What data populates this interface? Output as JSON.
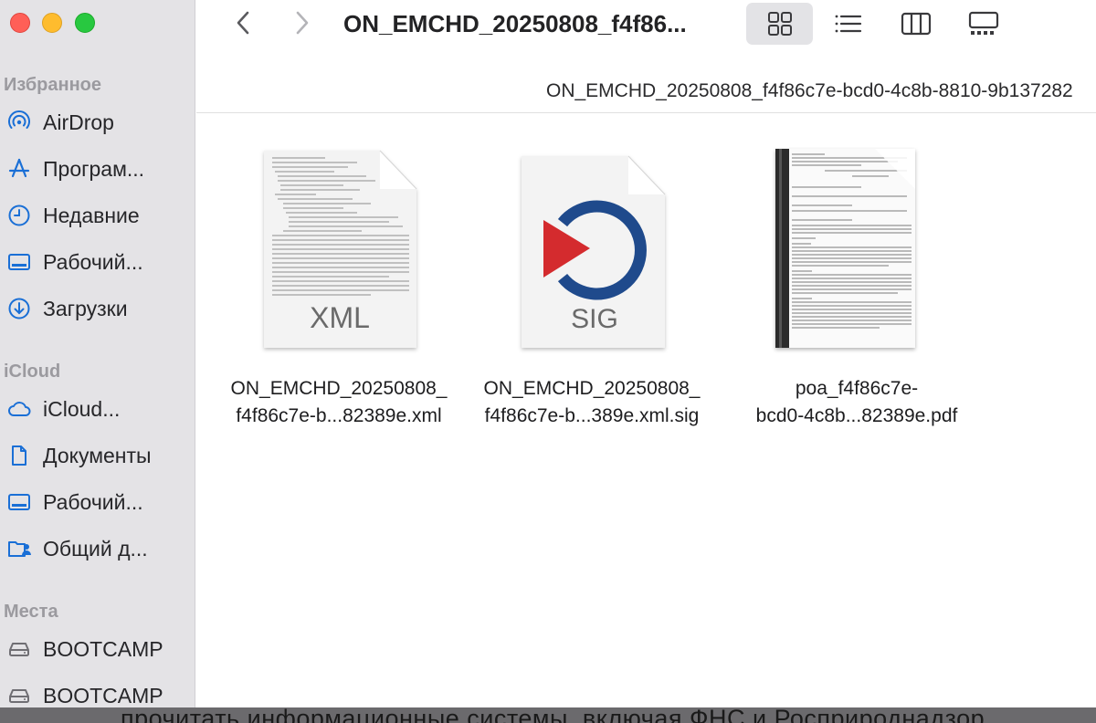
{
  "window": {
    "title": "ON_EMCHD_20250808_f4f86..."
  },
  "path_bar": {
    "current": "ON_EMCHD_20250808_f4f86c7e-bcd0-4c8b-8810-9b137282"
  },
  "toolbar": {
    "back_icon": "chevron-left-icon",
    "forward_icon": "chevron-right-icon",
    "views": [
      "icon-view",
      "list-view",
      "column-view",
      "gallery-view"
    ],
    "active_view": "icon-view"
  },
  "sidebar": {
    "favorites_title": "Избранное",
    "favorites": [
      {
        "label": "AirDrop",
        "icon": "airdrop-icon"
      },
      {
        "label": "Програм...",
        "icon": "applications-icon"
      },
      {
        "label": "Недавние",
        "icon": "clock-icon"
      },
      {
        "label": "Рабочий...",
        "icon": "desktop-icon"
      },
      {
        "label": "Загрузки",
        "icon": "downloads-icon"
      }
    ],
    "icloud_title": "iCloud",
    "icloud": [
      {
        "label": "iCloud...",
        "icon": "cloud-icon"
      },
      {
        "label": "Документы",
        "icon": "document-icon"
      },
      {
        "label": "Рабочий...",
        "icon": "desktop-icon"
      },
      {
        "label": "Общий д...",
        "icon": "shared-folder-icon"
      }
    ],
    "places_title": "Места",
    "places": [
      {
        "label": "BOOTCAMP",
        "icon": "drive-icon"
      },
      {
        "label": "BOOTCAMP",
        "icon": "drive-icon"
      }
    ]
  },
  "files": [
    {
      "name_line1": "ON_EMCHD_20250808_",
      "name_line2": "f4f86c7e-b...82389e.xml",
      "type_label": "XML"
    },
    {
      "name_line1": "ON_EMCHD_20250808_",
      "name_line2": "f4f86c7e-b...389e.xml.sig",
      "type_label": "SIG"
    },
    {
      "name_line1": "poa_f4f86c7e-",
      "name_line2": "bcd0-4c8b...82389e.pdf",
      "type_label": ""
    }
  ],
  "colors": {
    "accent": "#1a6fd6",
    "sidebar_bg": "#e4e3e6",
    "sig_red": "#d42b2e",
    "sig_blue": "#1f4a8c"
  },
  "bottom_strip_text": "прочитать информационные системы, включая ФНС и Росприроднадзор"
}
